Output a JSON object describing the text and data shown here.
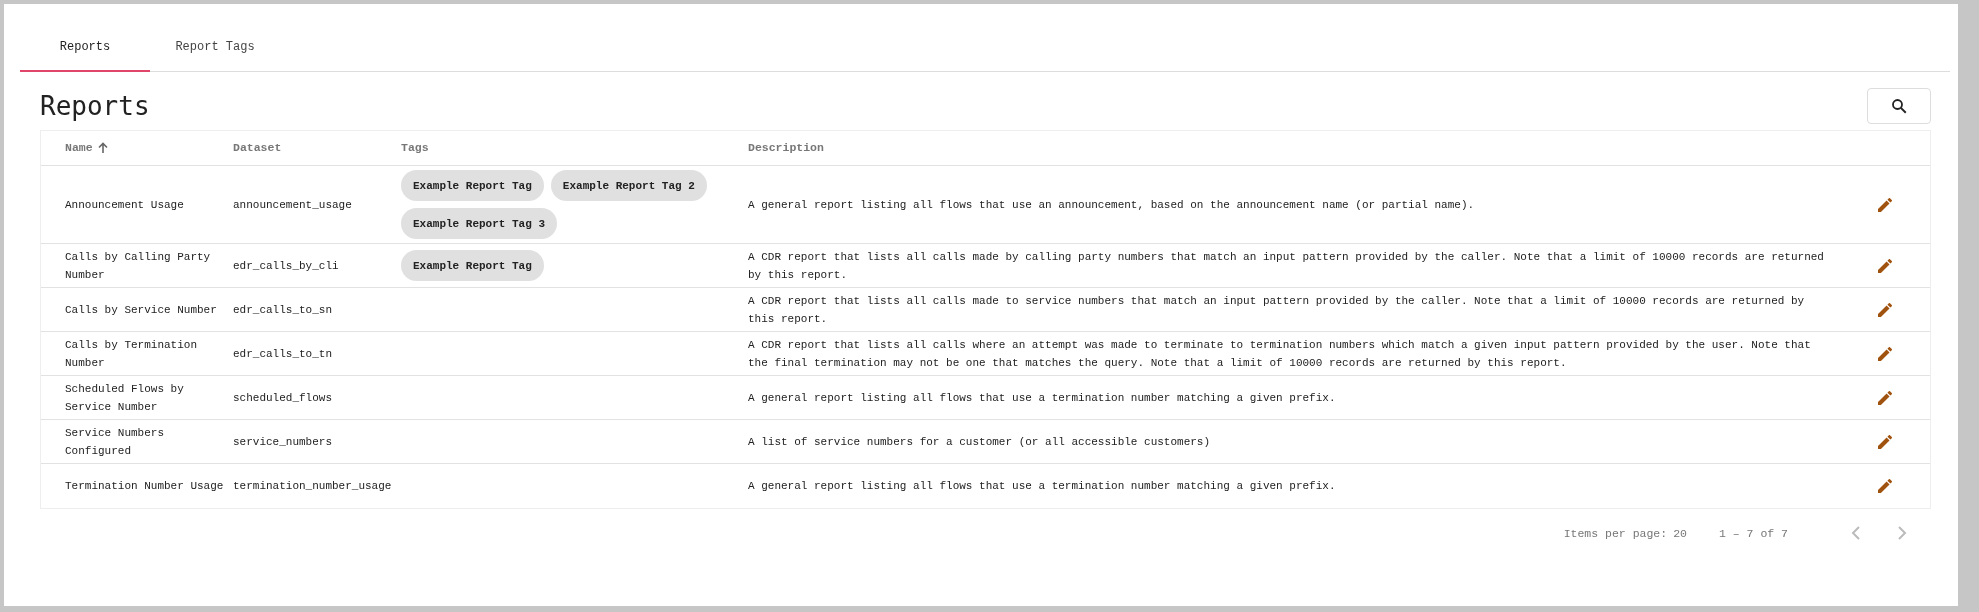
{
  "tabs": [
    {
      "label": "Reports",
      "selected": true
    },
    {
      "label": "Report Tags",
      "selected": false
    }
  ],
  "title": "Reports",
  "table": {
    "columns": [
      {
        "label": "Name",
        "sorted": true
      },
      {
        "label": "Dataset",
        "sorted": false
      },
      {
        "label": "Tags",
        "sorted": false
      },
      {
        "label": "Description",
        "sorted": false
      }
    ],
    "rows": [
      {
        "name": "Announcement Usage",
        "dataset": "announcement_usage",
        "tags": [
          "Example Report Tag",
          "Example Report Tag 2",
          "Example Report Tag 3"
        ],
        "description": "A general report listing all flows that use an announcement, based on the announcement name (or partial name)."
      },
      {
        "name": "Calls by Calling Party Number",
        "dataset": "edr_calls_by_cli",
        "tags": [
          "Example Report Tag"
        ],
        "description": "A CDR report that lists all calls made by calling party numbers that match an input pattern provided by the caller. Note that a limit of 10000 records are returned by this report."
      },
      {
        "name": "Calls by Service Number",
        "dataset": "edr_calls_to_sn",
        "tags": [],
        "description": "A CDR report that lists all calls made to service numbers that match an input pattern provided by the caller. Note that a limit of 10000 records are returned by this report."
      },
      {
        "name": "Calls by Termination Number",
        "dataset": "edr_calls_to_tn",
        "tags": [],
        "description": "A CDR report that lists all calls where an attempt was made to terminate to termination numbers which match a given input pattern provided by the user. Note that the final termination may not be one that matches the query. Note that a limit of 10000 records are returned by this report."
      },
      {
        "name": "Scheduled Flows by Service Number",
        "dataset": "scheduled_flows",
        "tags": [],
        "description": "A general report listing all flows that use a termination number matching a given prefix."
      },
      {
        "name": "Service Numbers Configured",
        "dataset": "service_numbers",
        "tags": [],
        "description": "A list of service numbers for a customer (or all accessible customers)"
      },
      {
        "name": "Termination Number Usage",
        "dataset": "termination_number_usage",
        "tags": [],
        "description": "A general report listing all flows that use a termination number matching a given prefix."
      }
    ]
  },
  "paginator": {
    "items_per_page_label": "Items per page:",
    "items_per_page": "20",
    "range": "1 – 7 of 7",
    "previous_disabled": true,
    "next_disabled": true
  }
}
